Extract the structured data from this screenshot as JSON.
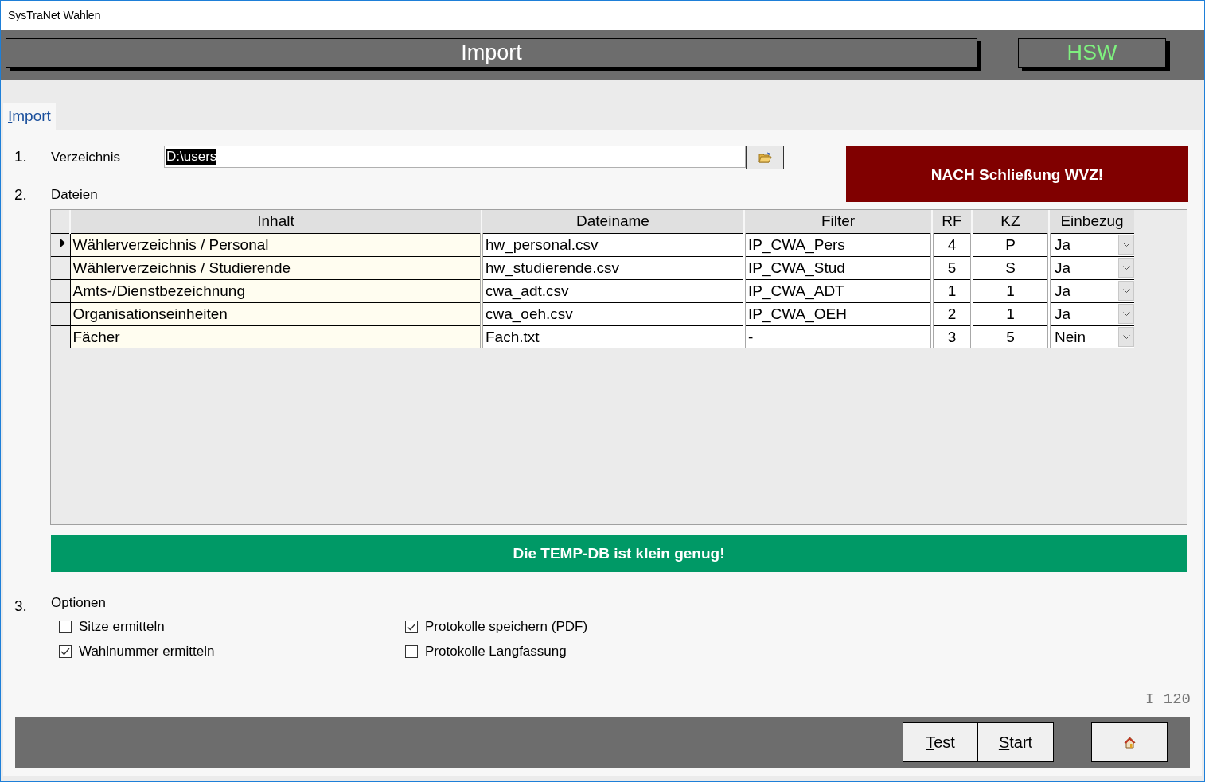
{
  "window": {
    "title": "SysTraNet Wahlen"
  },
  "header": {
    "title": "Import",
    "badge": "HSW"
  },
  "tabs": [
    {
      "label": "Import",
      "selected": true
    }
  ],
  "steps": [
    {
      "number": "1.",
      "label": "Verzeichnis"
    },
    {
      "number": "2.",
      "label": "Dateien"
    },
    {
      "number": "3.",
      "label": "Optionen"
    }
  ],
  "directory_field": {
    "value": "D:\\users"
  },
  "warning": "NACH Schließung WVZ!",
  "table": {
    "columns": [
      "Inhalt",
      "Dateiname",
      "Filter",
      "RF",
      "KZ",
      "Einbezug"
    ],
    "rows": [
      {
        "selected": true,
        "cells": [
          "Wählerverzeichnis / Personal",
          "hw_personal.csv",
          "IP_CWA_Pers",
          "4",
          "P",
          "Ja"
        ]
      },
      {
        "selected": false,
        "cells": [
          "Wählerverzeichnis / Studierende",
          "hw_studierende.csv",
          "IP_CWA_Stud",
          "5",
          "S",
          "Ja"
        ]
      },
      {
        "selected": false,
        "cells": [
          "Amts-/Dienstbezeichnung",
          "cwa_adt.csv",
          "IP_CWA_ADT",
          "1",
          "1",
          "Ja"
        ]
      },
      {
        "selected": false,
        "cells": [
          "Organisationseinheiten",
          "cwa_oeh.csv",
          "IP_CWA_OEH",
          "2",
          "1",
          "Ja"
        ]
      },
      {
        "selected": false,
        "cells": [
          "Fächer",
          "Fach.txt",
          "-",
          "3",
          "5",
          "Nein"
        ]
      }
    ]
  },
  "status_banner": "Die TEMP-DB ist klein genug!",
  "options": [
    {
      "label": "Sitze ermitteln",
      "checked": false
    },
    {
      "label": "Protokolle speichern (PDF)",
      "checked": true
    },
    {
      "label": "Wahlnummer ermitteln",
      "checked": true
    },
    {
      "label": "Protokolle Langfassung",
      "checked": false
    }
  ],
  "code": "I 120",
  "buttons": [
    "Test",
    "Start"
  ]
}
